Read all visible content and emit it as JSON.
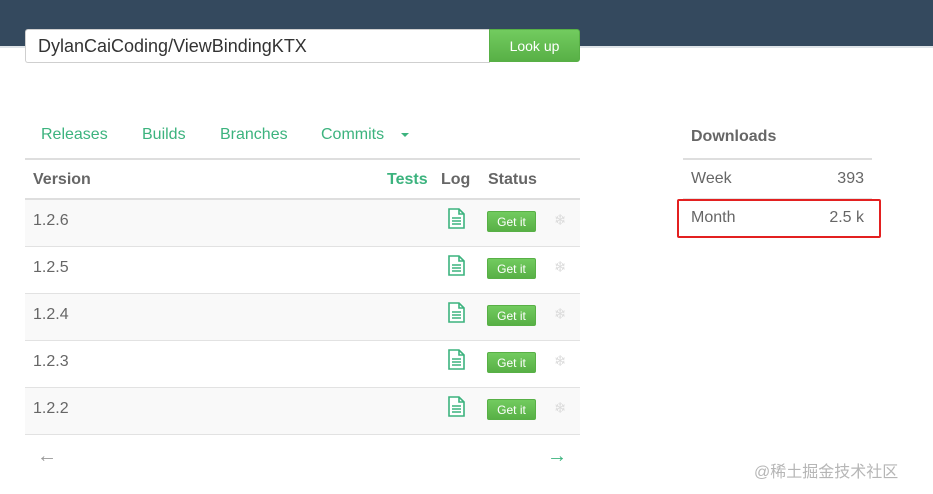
{
  "search": {
    "value": "DylanCaiCoding/ViewBindingKTX",
    "button_label": "Look up"
  },
  "tabs": [
    {
      "label": "Releases"
    },
    {
      "label": "Builds"
    },
    {
      "label": "Branches"
    },
    {
      "label": "Commits"
    }
  ],
  "table": {
    "headers": {
      "version": "Version",
      "tests": "Tests",
      "log": "Log",
      "status": "Status"
    },
    "rows": [
      {
        "version": "1.2.6",
        "status_button": "Get it"
      },
      {
        "version": "1.2.5",
        "status_button": "Get it"
      },
      {
        "version": "1.2.4",
        "status_button": "Get it"
      },
      {
        "version": "1.2.3",
        "status_button": "Get it"
      },
      {
        "version": "1.2.2",
        "status_button": "Get it"
      }
    ]
  },
  "pager": {
    "prev": "←",
    "next": "→"
  },
  "downloads": {
    "title": "Downloads",
    "week_label": "Week",
    "week_value": "393",
    "month_label": "Month",
    "month_value": "2.5 k"
  },
  "watermark": "@稀土掘金技术社区",
  "icons": {
    "log": "document-icon",
    "extra": "snowflake-icon",
    "dropdown": "caret-down-icon"
  },
  "colors": {
    "topbar": "#34495e",
    "accent_green": "#3cb37e",
    "button_green": "#5cb85c",
    "highlight_red": "#e32020"
  }
}
